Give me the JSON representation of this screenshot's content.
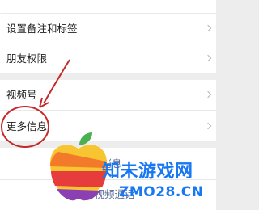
{
  "menu": {
    "items": [
      {
        "label": "设置备注和标签"
      },
      {
        "label": "朋友权限"
      },
      {
        "label": "视频号"
      },
      {
        "label": "更多信息"
      }
    ]
  },
  "actions": {
    "send_message": "发消息",
    "video_call": "音视频通话"
  },
  "watermark": {
    "cn_text": "知未游戏网",
    "domain": "ZMO28.CN"
  },
  "colors": {
    "background": "#ededed",
    "row_bg": "#ffffff",
    "action_link": "#576b95",
    "annotation_red": "#c62828",
    "watermark_blue": "#1877f2"
  }
}
